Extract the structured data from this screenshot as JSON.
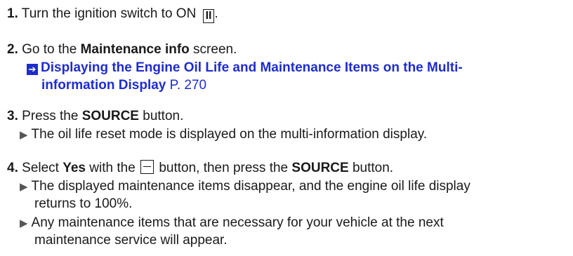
{
  "steps": [
    {
      "num": "1.",
      "pre": "Turn the ignition switch to ON",
      "key": "II",
      "post": "."
    },
    {
      "num": "2.",
      "pre": "Go to the ",
      "bold": "Maintenance info",
      "post": " screen."
    },
    {
      "num": "3.",
      "pre": "Press the ",
      "bold": "SOURCE",
      "post": " button."
    },
    {
      "num": "4.",
      "pre": "Select ",
      "bold": "Yes",
      "mid": " with the ",
      "post_a": " button, then press the ",
      "bold2": "SOURCE",
      "post": " button."
    }
  ],
  "link": {
    "line1": "Displaying the Engine Oil Life and Maintenance Items on the Multi-",
    "line2": "information Display",
    "page": " P. 270"
  },
  "results": {
    "step3": "The oil life reset mode is displayed on the multi-information display.",
    "step4a_line1": "The displayed maintenance items disappear, and the engine oil life display",
    "step4a_line2": "returns to 100%.",
    "step4b_line1": "Any maintenance items that are necessary for your vehicle at the next",
    "step4b_line2": "maintenance service will appear."
  },
  "icons": {
    "result_marker": "result-triangle-icon",
    "link_marker": "link-arrow-icon",
    "minus_button": "minus-button-icon"
  }
}
